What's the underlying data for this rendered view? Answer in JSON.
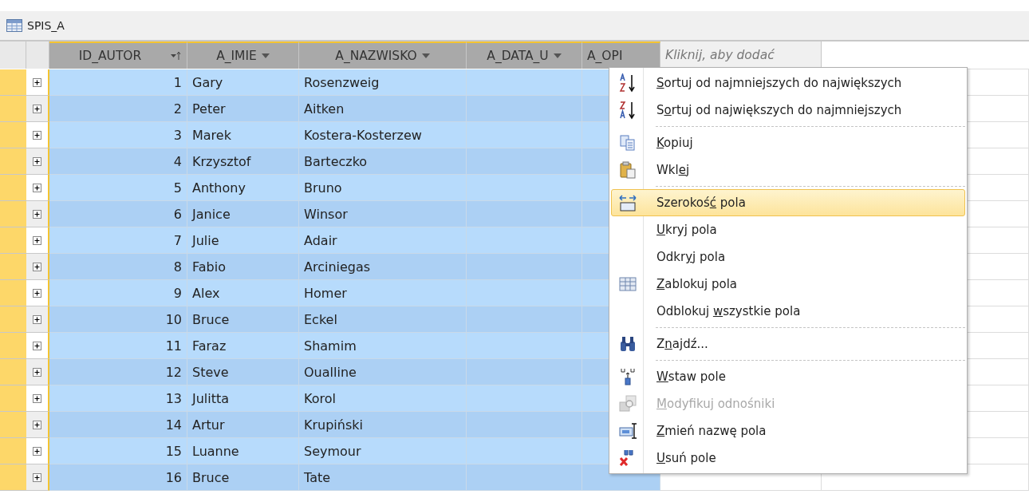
{
  "tab": {
    "title": "SPIS_A"
  },
  "columns": [
    {
      "label": "ID_AUTOR",
      "kind": "number",
      "selected": true,
      "sorted": true
    },
    {
      "label": "A_IMIE",
      "kind": "text",
      "selected": true,
      "sorted": false
    },
    {
      "label": "A_NAZWISKO",
      "kind": "text",
      "selected": true,
      "sorted": false
    },
    {
      "label": "A_DATA_U",
      "kind": "text",
      "selected": true,
      "sorted": false
    },
    {
      "label": "A_OPI",
      "kind": "cut",
      "selected": true
    },
    {
      "label": "Kliknij, aby dodać",
      "kind": "add",
      "selected": false
    }
  ],
  "rows": [
    {
      "cells": [
        "1",
        "Gary",
        "Rosenzweig"
      ]
    },
    {
      "cells": [
        "2",
        "Peter",
        "Aitken"
      ]
    },
    {
      "cells": [
        "3",
        "Marek",
        "Kostera-Kosterzew"
      ]
    },
    {
      "cells": [
        "4",
        "Krzysztof",
        "Barteczko"
      ]
    },
    {
      "cells": [
        "5",
        "Anthony",
        "Bruno"
      ]
    },
    {
      "cells": [
        "6",
        "Janice",
        "Winsor"
      ]
    },
    {
      "cells": [
        "7",
        "Julie",
        "Adair"
      ]
    },
    {
      "cells": [
        "8",
        "Fabio",
        "Arciniegas"
      ]
    },
    {
      "cells": [
        "9",
        "Alex",
        "Homer"
      ]
    },
    {
      "cells": [
        "10",
        "Bruce",
        "Eckel"
      ]
    },
    {
      "cells": [
        "11",
        "Faraz",
        "Shamim"
      ]
    },
    {
      "cells": [
        "12",
        "Steve",
        "Oualline"
      ]
    },
    {
      "cells": [
        "13",
        "Julitta",
        "Korol"
      ]
    },
    {
      "cells": [
        "14",
        "Artur",
        "Krupiński"
      ]
    },
    {
      "cells": [
        "15",
        "Luanne",
        "Seymour"
      ]
    },
    {
      "cells": [
        "16",
        "Bruce",
        "Tate"
      ]
    }
  ],
  "context_menu": [
    {
      "kind": "item",
      "key": "S",
      "after": "ortuj od najmniejszych do największych",
      "selected": false,
      "disabled": false
    },
    {
      "kind": "item",
      "before": "S",
      "key": "o",
      "after": "rtuj od największych do najmniejszych",
      "selected": false,
      "disabled": false
    },
    {
      "kind": "separator"
    },
    {
      "kind": "item",
      "key": "K",
      "after": "opiuj",
      "selected": false,
      "disabled": false
    },
    {
      "kind": "item",
      "before": "Wkl",
      "key": "e",
      "after": "j",
      "selected": false,
      "disabled": false
    },
    {
      "kind": "separator"
    },
    {
      "kind": "item",
      "before": "Szerokoś",
      "key": "ć",
      "after": " pola",
      "selected": true,
      "disabled": false
    },
    {
      "kind": "item",
      "key": "U",
      "after": "kryj pola",
      "selected": false,
      "disabled": false
    },
    {
      "kind": "item",
      "before": "Odkr",
      "key": "y",
      "after": "j pola",
      "selected": false,
      "disabled": false
    },
    {
      "kind": "item",
      "key": "Z",
      "after": "ablokuj pola",
      "selected": false,
      "disabled": false
    },
    {
      "kind": "item",
      "before": "Odblokuj ",
      "key": "w",
      "after": "szystkie pola",
      "selected": false,
      "disabled": false
    },
    {
      "kind": "separator"
    },
    {
      "kind": "item",
      "before": "Z",
      "key": "n",
      "after": "ajdź...",
      "selected": false,
      "disabled": false
    },
    {
      "kind": "separator"
    },
    {
      "kind": "item",
      "key": "W",
      "after": "staw pole",
      "selected": false,
      "disabled": false
    },
    {
      "kind": "item",
      "key": "M",
      "after": "odyfikuj odnośniki",
      "selected": false,
      "disabled": true
    },
    {
      "kind": "item",
      "key": "Z",
      "after": "mień nazwę pola",
      "selected": false,
      "disabled": false
    },
    {
      "kind": "item",
      "key": "U",
      "after": "suń pole",
      "selected": false,
      "disabled": false
    }
  ]
}
